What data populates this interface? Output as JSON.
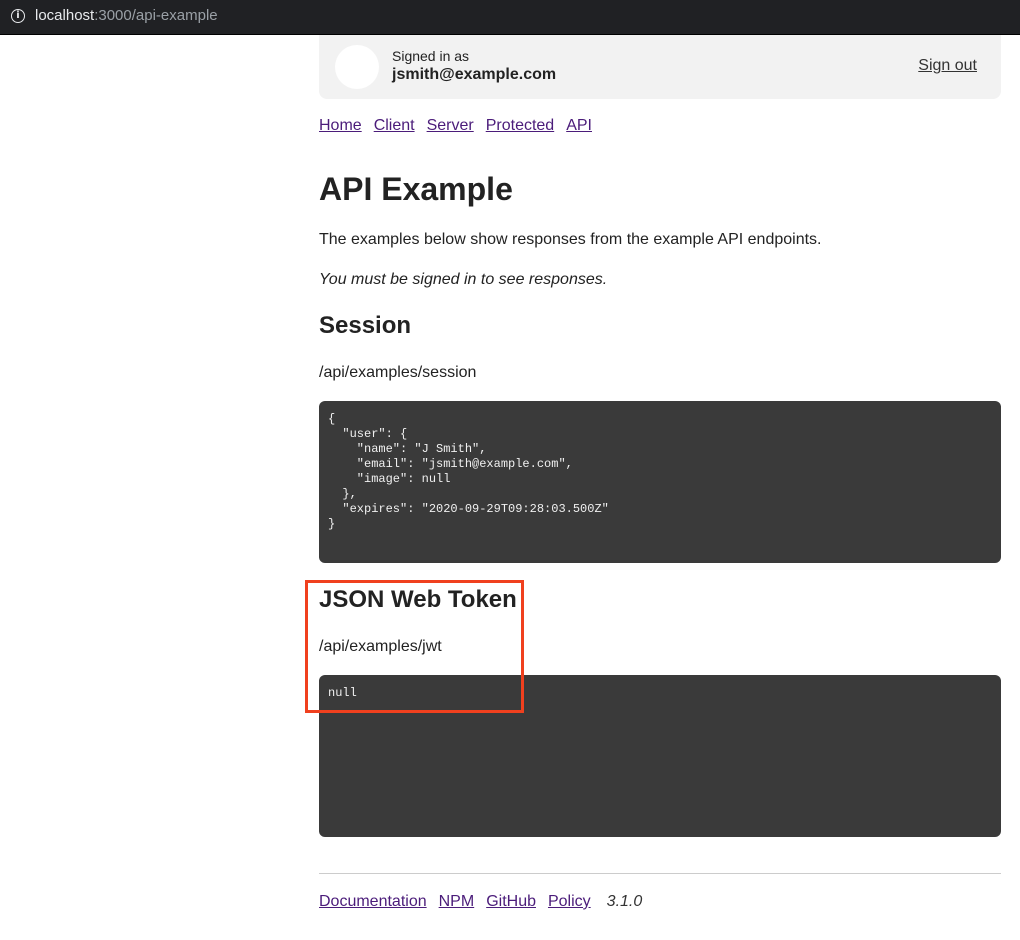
{
  "browser": {
    "url_host": "localhost",
    "url_path": ":3000/api-example"
  },
  "header": {
    "signed_in_label": "Signed in as",
    "email": "jsmith@example.com",
    "sign_out": "Sign out"
  },
  "nav": {
    "items": [
      {
        "label": "Home"
      },
      {
        "label": "Client"
      },
      {
        "label": "Server"
      },
      {
        "label": "Protected"
      },
      {
        "label": "API"
      }
    ]
  },
  "main": {
    "title": "API Example",
    "intro": "The examples below show responses from the example API endpoints.",
    "notice": "You must be signed in to see responses.",
    "session": {
      "heading": "Session",
      "endpoint": "/api/examples/session",
      "response": "{\n  \"user\": {\n    \"name\": \"J Smith\",\n    \"email\": \"jsmith@example.com\",\n    \"image\": null\n  },\n  \"expires\": \"2020-09-29T09:28:03.500Z\"\n}"
    },
    "jwt": {
      "heading": "JSON Web Token",
      "endpoint": "/api/examples/jwt",
      "response": "null"
    }
  },
  "footer": {
    "links": [
      {
        "label": "Documentation"
      },
      {
        "label": "NPM"
      },
      {
        "label": "GitHub"
      },
      {
        "label": "Policy"
      }
    ],
    "version": "3.1.0"
  },
  "colors": {
    "link": "#4b1c7a",
    "code_bg": "#3a3a3a",
    "highlight": "#f0401e",
    "header_bg": "#f2f2f2"
  }
}
